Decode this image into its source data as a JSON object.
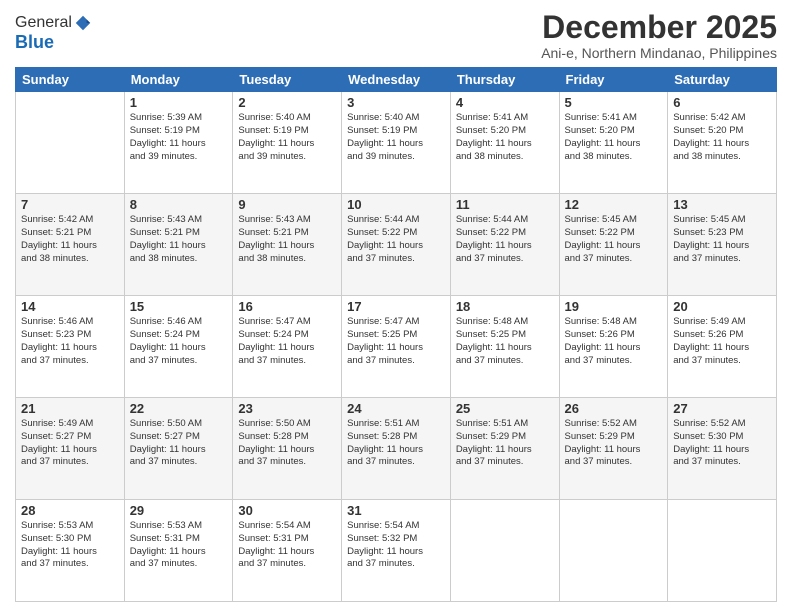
{
  "header": {
    "logo_line1": "General",
    "logo_line2": "Blue",
    "month_title": "December 2025",
    "subtitle": "Ani-e, Northern Mindanao, Philippines"
  },
  "weekdays": [
    "Sunday",
    "Monday",
    "Tuesday",
    "Wednesday",
    "Thursday",
    "Friday",
    "Saturday"
  ],
  "weeks": [
    [
      {
        "day": "",
        "info": ""
      },
      {
        "day": "1",
        "info": "Sunrise: 5:39 AM\nSunset: 5:19 PM\nDaylight: 11 hours\nand 39 minutes."
      },
      {
        "day": "2",
        "info": "Sunrise: 5:40 AM\nSunset: 5:19 PM\nDaylight: 11 hours\nand 39 minutes."
      },
      {
        "day": "3",
        "info": "Sunrise: 5:40 AM\nSunset: 5:19 PM\nDaylight: 11 hours\nand 39 minutes."
      },
      {
        "day": "4",
        "info": "Sunrise: 5:41 AM\nSunset: 5:20 PM\nDaylight: 11 hours\nand 38 minutes."
      },
      {
        "day": "5",
        "info": "Sunrise: 5:41 AM\nSunset: 5:20 PM\nDaylight: 11 hours\nand 38 minutes."
      },
      {
        "day": "6",
        "info": "Sunrise: 5:42 AM\nSunset: 5:20 PM\nDaylight: 11 hours\nand 38 minutes."
      }
    ],
    [
      {
        "day": "7",
        "info": "Sunrise: 5:42 AM\nSunset: 5:21 PM\nDaylight: 11 hours\nand 38 minutes."
      },
      {
        "day": "8",
        "info": "Sunrise: 5:43 AM\nSunset: 5:21 PM\nDaylight: 11 hours\nand 38 minutes."
      },
      {
        "day": "9",
        "info": "Sunrise: 5:43 AM\nSunset: 5:21 PM\nDaylight: 11 hours\nand 38 minutes."
      },
      {
        "day": "10",
        "info": "Sunrise: 5:44 AM\nSunset: 5:22 PM\nDaylight: 11 hours\nand 37 minutes."
      },
      {
        "day": "11",
        "info": "Sunrise: 5:44 AM\nSunset: 5:22 PM\nDaylight: 11 hours\nand 37 minutes."
      },
      {
        "day": "12",
        "info": "Sunrise: 5:45 AM\nSunset: 5:22 PM\nDaylight: 11 hours\nand 37 minutes."
      },
      {
        "day": "13",
        "info": "Sunrise: 5:45 AM\nSunset: 5:23 PM\nDaylight: 11 hours\nand 37 minutes."
      }
    ],
    [
      {
        "day": "14",
        "info": "Sunrise: 5:46 AM\nSunset: 5:23 PM\nDaylight: 11 hours\nand 37 minutes."
      },
      {
        "day": "15",
        "info": "Sunrise: 5:46 AM\nSunset: 5:24 PM\nDaylight: 11 hours\nand 37 minutes."
      },
      {
        "day": "16",
        "info": "Sunrise: 5:47 AM\nSunset: 5:24 PM\nDaylight: 11 hours\nand 37 minutes."
      },
      {
        "day": "17",
        "info": "Sunrise: 5:47 AM\nSunset: 5:25 PM\nDaylight: 11 hours\nand 37 minutes."
      },
      {
        "day": "18",
        "info": "Sunrise: 5:48 AM\nSunset: 5:25 PM\nDaylight: 11 hours\nand 37 minutes."
      },
      {
        "day": "19",
        "info": "Sunrise: 5:48 AM\nSunset: 5:26 PM\nDaylight: 11 hours\nand 37 minutes."
      },
      {
        "day": "20",
        "info": "Sunrise: 5:49 AM\nSunset: 5:26 PM\nDaylight: 11 hours\nand 37 minutes."
      }
    ],
    [
      {
        "day": "21",
        "info": "Sunrise: 5:49 AM\nSunset: 5:27 PM\nDaylight: 11 hours\nand 37 minutes."
      },
      {
        "day": "22",
        "info": "Sunrise: 5:50 AM\nSunset: 5:27 PM\nDaylight: 11 hours\nand 37 minutes."
      },
      {
        "day": "23",
        "info": "Sunrise: 5:50 AM\nSunset: 5:28 PM\nDaylight: 11 hours\nand 37 minutes."
      },
      {
        "day": "24",
        "info": "Sunrise: 5:51 AM\nSunset: 5:28 PM\nDaylight: 11 hours\nand 37 minutes."
      },
      {
        "day": "25",
        "info": "Sunrise: 5:51 AM\nSunset: 5:29 PM\nDaylight: 11 hours\nand 37 minutes."
      },
      {
        "day": "26",
        "info": "Sunrise: 5:52 AM\nSunset: 5:29 PM\nDaylight: 11 hours\nand 37 minutes."
      },
      {
        "day": "27",
        "info": "Sunrise: 5:52 AM\nSunset: 5:30 PM\nDaylight: 11 hours\nand 37 minutes."
      }
    ],
    [
      {
        "day": "28",
        "info": "Sunrise: 5:53 AM\nSunset: 5:30 PM\nDaylight: 11 hours\nand 37 minutes."
      },
      {
        "day": "29",
        "info": "Sunrise: 5:53 AM\nSunset: 5:31 PM\nDaylight: 11 hours\nand 37 minutes."
      },
      {
        "day": "30",
        "info": "Sunrise: 5:54 AM\nSunset: 5:31 PM\nDaylight: 11 hours\nand 37 minutes."
      },
      {
        "day": "31",
        "info": "Sunrise: 5:54 AM\nSunset: 5:32 PM\nDaylight: 11 hours\nand 37 minutes."
      },
      {
        "day": "",
        "info": ""
      },
      {
        "day": "",
        "info": ""
      },
      {
        "day": "",
        "info": ""
      }
    ]
  ]
}
